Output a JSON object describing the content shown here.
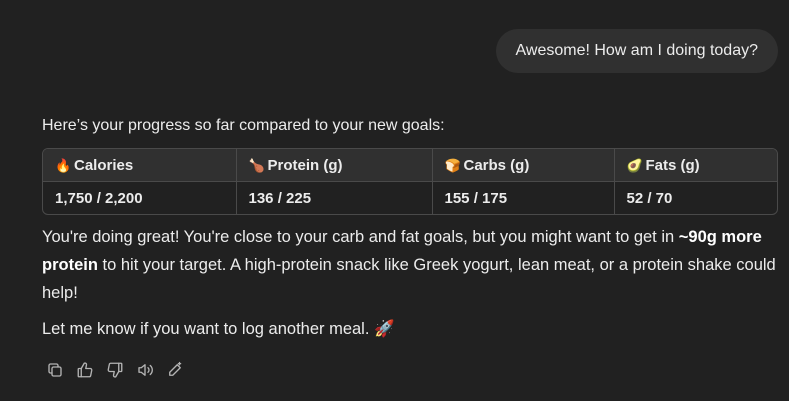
{
  "user_message": "Awesome! How am I doing today?",
  "assistant": {
    "intro": "Here’s your progress so far compared to your new goals:",
    "table": {
      "headers": [
        {
          "emoji": "🔥",
          "label": "Calories"
        },
        {
          "emoji": "🍗",
          "label": "Protein (g)"
        },
        {
          "emoji": "🍞",
          "label": "Carbs (g)"
        },
        {
          "emoji": "🥑",
          "label": "Fats (g)"
        }
      ],
      "row": [
        "1,750 / 2,200",
        "136 / 225",
        "155 / 175",
        "52 / 70"
      ]
    },
    "response_part1": "You're doing great! You're close to your carb and fat goals, but you might want to get in ",
    "response_bold": "~90g more protein",
    "response_part2": " to hit your target. A high-protein snack like Greek yogurt, lean meat, or a protein shake could help!",
    "closing": "Let me know if you want to log another meal.",
    "closing_emoji": "🚀"
  },
  "actions": [
    {
      "icon": "copy-icon"
    },
    {
      "icon": "thumbs-up-icon"
    },
    {
      "icon": "thumbs-down-icon"
    },
    {
      "icon": "read-aloud-icon"
    },
    {
      "icon": "edit-icon"
    }
  ],
  "colors": {
    "background": "#212121",
    "bubble": "#303030",
    "table_header": "#303030",
    "border": "#4a4a4a",
    "text": "#ececec",
    "icon": "#b4b4b4"
  }
}
